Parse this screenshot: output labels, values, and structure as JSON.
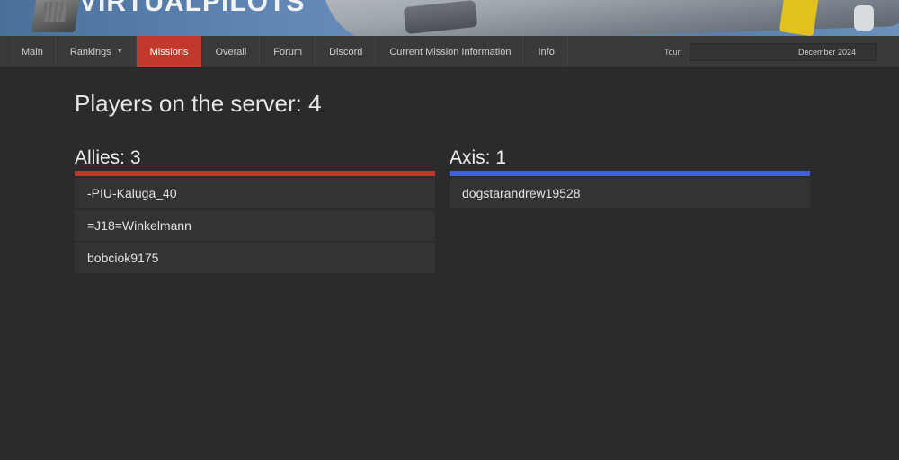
{
  "banner": {
    "logo_text": "VIRTUALPILOTS"
  },
  "nav": {
    "items": [
      {
        "label": "Main"
      },
      {
        "label": "Rankings"
      },
      {
        "label": "Missions"
      },
      {
        "label": "Overall"
      },
      {
        "label": "Forum"
      },
      {
        "label": "Discord"
      },
      {
        "label": "Current Mission Information"
      },
      {
        "label": "Info"
      }
    ],
    "active": "Missions",
    "tour_label": "Tour:",
    "tour_value": "December 2024"
  },
  "page": {
    "title": "Players on the server: 4"
  },
  "allies": {
    "heading": "Allies: 3",
    "color": "#c0392b",
    "players": [
      "-PIU-Kaluga_40",
      "=J18=Winkelmann",
      "bobciok9175"
    ]
  },
  "axis": {
    "heading": "Axis: 1",
    "color": "#3f63d1",
    "players": [
      "dogstarandrew19528"
    ]
  },
  "icons": {
    "rankings_caret": "caret-down-icon"
  }
}
